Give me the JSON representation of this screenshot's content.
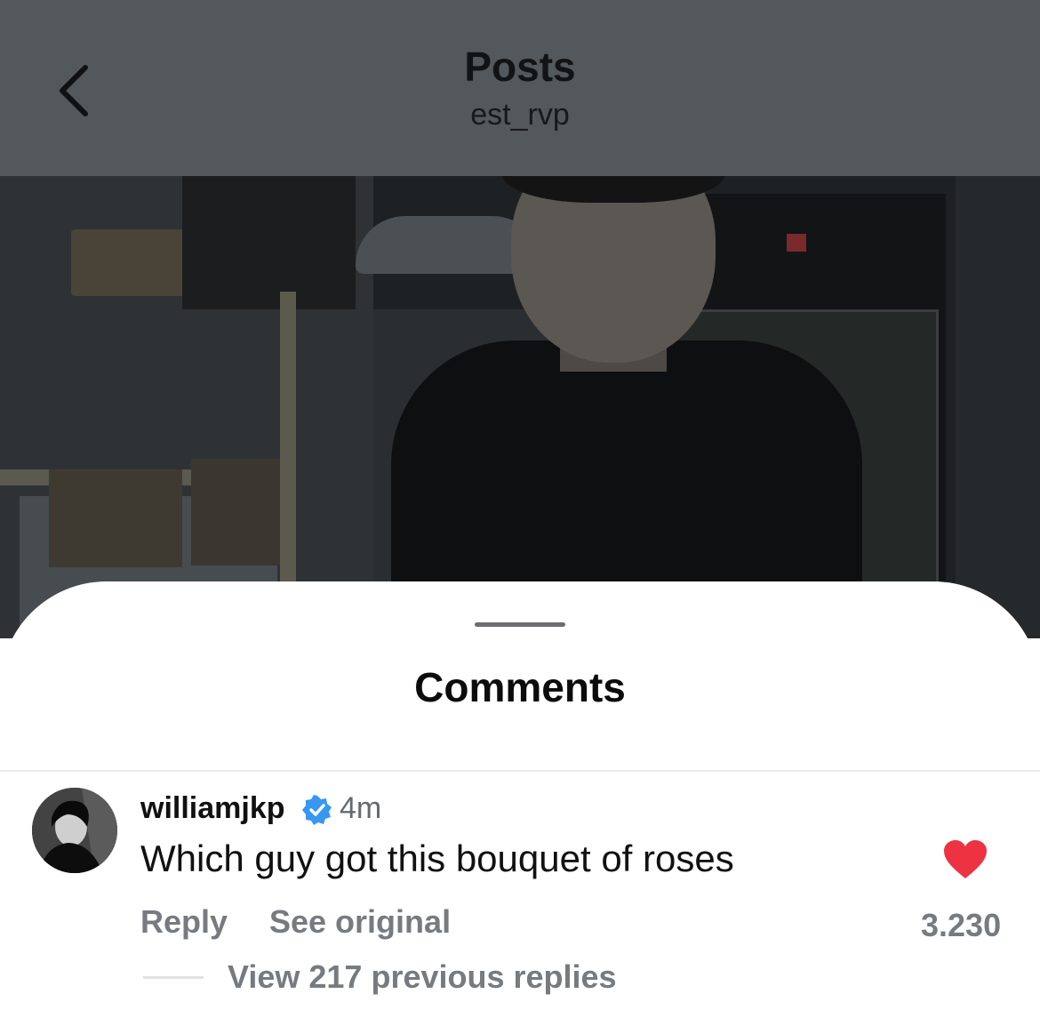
{
  "header": {
    "title": "Posts",
    "subtitle": "est_rvp",
    "back_icon": "chevron-left-icon"
  },
  "sheet": {
    "title": "Comments"
  },
  "comment": {
    "username": "williamjkp",
    "verified_icon": "verified-badge-icon",
    "time": "4m",
    "text": "Which guy got this bouquet of roses",
    "reply_label": "Reply",
    "see_original_label": "See original",
    "like_count": "3.230",
    "liked": true,
    "view_replies_label": "View 217 previous replies"
  },
  "colors": {
    "header_dim": "#53585c",
    "heart": "#ed3341",
    "verified": "#3897f0",
    "secondary_text": "#777b80"
  }
}
